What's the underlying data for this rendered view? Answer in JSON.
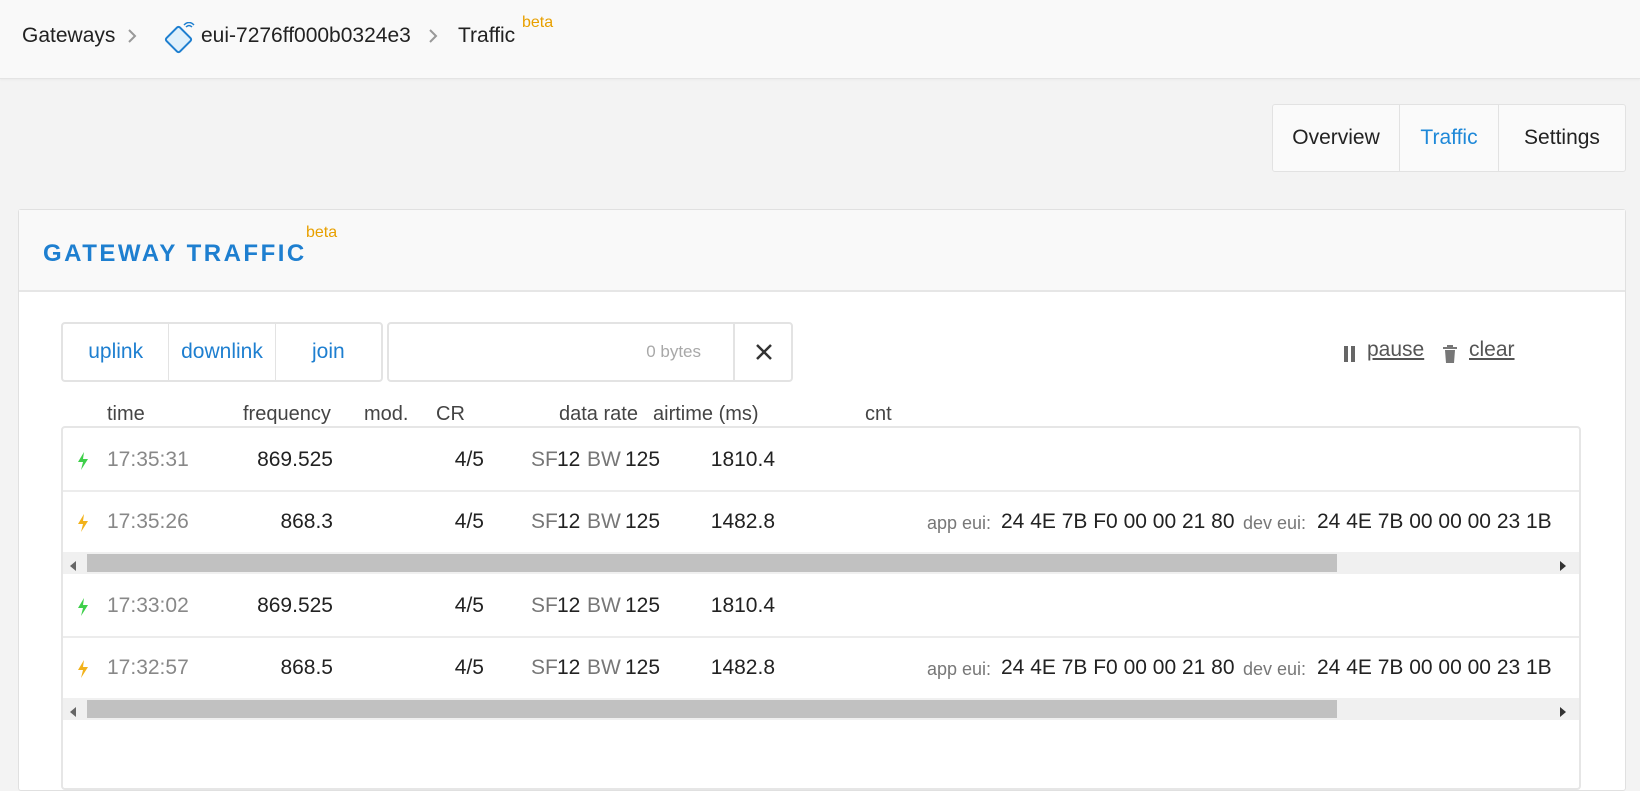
{
  "breadcrumb": {
    "root": "Gateways",
    "gateway": "eui-7276ff000b0324e3",
    "current": "Traffic",
    "badge": "beta",
    "gateway_icon": "gateway-icon",
    "separator_icon": "chevron-right-icon"
  },
  "tabs": [
    {
      "label": "Overview",
      "active": false
    },
    {
      "label": "Traffic",
      "active": true
    },
    {
      "label": "Settings",
      "active": false
    }
  ],
  "card": {
    "title": "GATEWAY TRAFFIC",
    "badge": "beta"
  },
  "filters": {
    "uplink": "uplink",
    "downlink": "downlink",
    "join": "join"
  },
  "search": {
    "placeholder": "0 bytes",
    "value": "",
    "clear_icon": "close-icon"
  },
  "actions": {
    "pause_label": "pause",
    "pause_icon": "pause-icon",
    "clear_label": "clear",
    "clear_icon": "trash-icon"
  },
  "columns": [
    "time",
    "frequency",
    "mod.",
    "CR",
    "data rate",
    "airtime (ms)",
    "cnt"
  ],
  "rows": [
    {
      "type": "uplink",
      "icon": "bolt-green-icon",
      "time": "17:35:31",
      "frequency": "869.525",
      "cr": "4/5",
      "sf_label": "SF",
      "sf": "12",
      "bw_label": "BW",
      "bw": "125",
      "airtime": "1810.4"
    },
    {
      "type": "join",
      "icon": "bolt-yellow-icon",
      "time": "17:35:26",
      "frequency": "868.3",
      "cr": "4/5",
      "sf_label": "SF",
      "sf": "12",
      "bw_label": "BW",
      "bw": "125",
      "airtime": "1482.8",
      "app_eui_label": "app eui:",
      "app_eui": "24 4E 7B F0 00 00 21 80",
      "dev_eui_label": "dev eui:",
      "dev_eui": "24 4E 7B 00 00 00 23 1B"
    },
    {
      "type": "uplink",
      "icon": "bolt-green-icon",
      "time": "17:33:02",
      "frequency": "869.525",
      "cr": "4/5",
      "sf_label": "SF",
      "sf": "12",
      "bw_label": "BW",
      "bw": "125",
      "airtime": "1810.4"
    },
    {
      "type": "join",
      "icon": "bolt-yellow-icon",
      "time": "17:32:57",
      "frequency": "868.5",
      "cr": "4/5",
      "sf_label": "SF",
      "sf": "12",
      "bw_label": "BW",
      "bw": "125",
      "airtime": "1482.8",
      "app_eui_label": "app eui:",
      "app_eui": "24 4E 7B F0 00 00 21 80",
      "dev_eui_label": "dev eui:",
      "dev_eui": "24 4E 7B 00 00 00 23 1B"
    }
  ],
  "colors": {
    "accent": "#1e7fd0",
    "beta": "#e8a000",
    "uplink_bolt": "#3ecf4a",
    "join_bolt": "#f2b21b"
  }
}
